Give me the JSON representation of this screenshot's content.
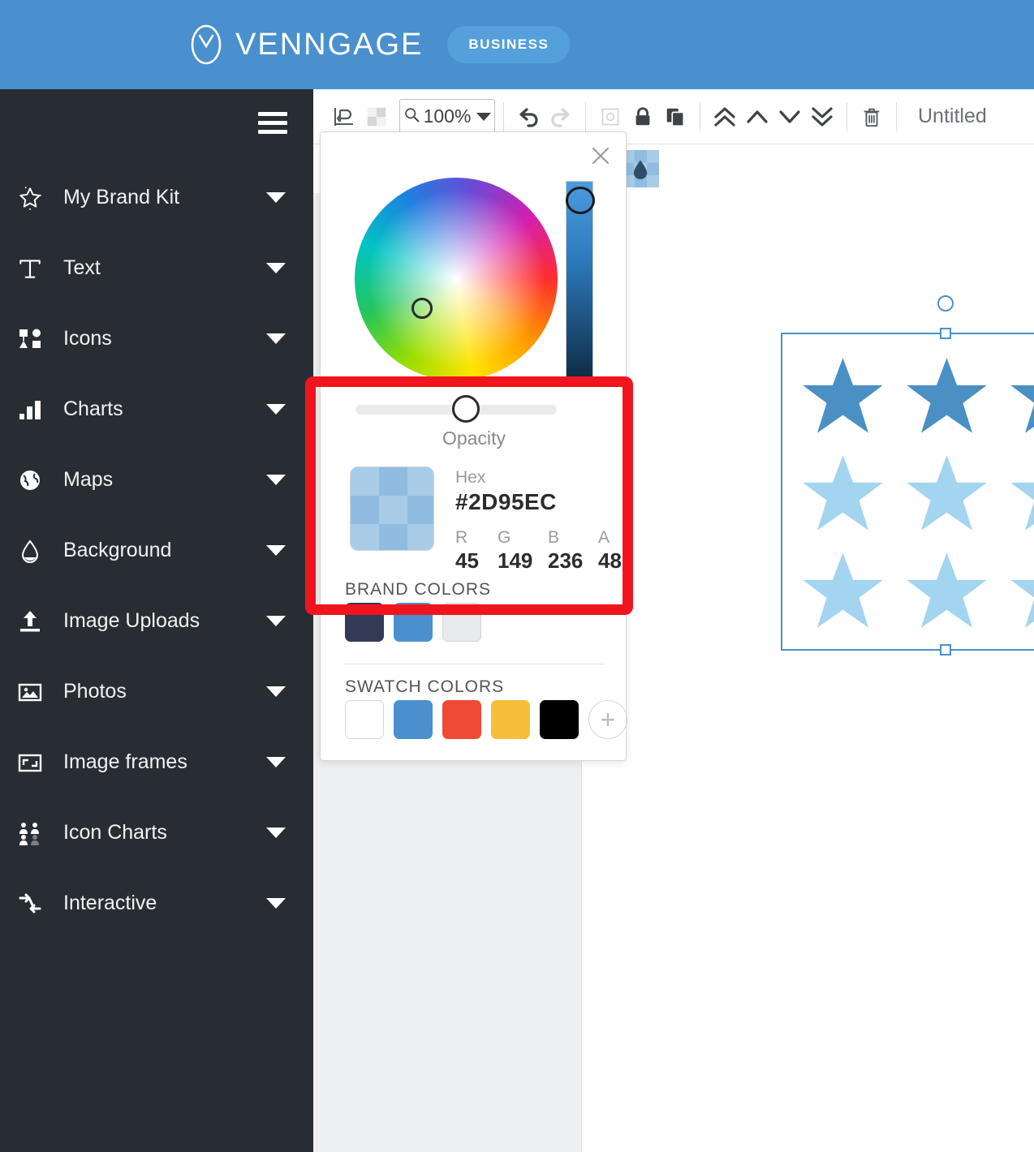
{
  "header": {
    "logo_icon": "venngage-logo-icon",
    "brand_name": "VENNGAGE",
    "plan_badge": "BUSINESS",
    "background_color": "#4A90CF"
  },
  "sidebar": {
    "menu_icon": "hamburger-icon",
    "background_color": "#282D33",
    "items": [
      {
        "label": "My Brand Kit",
        "icon": "star-sparkle-icon"
      },
      {
        "label": "Text",
        "icon": "text-t-icon"
      },
      {
        "label": "Icons",
        "icon": "shapes-icon"
      },
      {
        "label": "Charts",
        "icon": "bar-chart-icon"
      },
      {
        "label": "Maps",
        "icon": "globe-icon"
      },
      {
        "label": "Background",
        "icon": "droplet-icon"
      },
      {
        "label": "Image Uploads",
        "icon": "upload-arrow-icon"
      },
      {
        "label": "Photos",
        "icon": "photo-icon"
      },
      {
        "label": "Image frames",
        "icon": "image-frame-icon"
      },
      {
        "label": "Icon Charts",
        "icon": "people-chart-icon"
      },
      {
        "label": "Interactive",
        "icon": "shuffle-arrows-icon"
      }
    ]
  },
  "toolbar": {
    "align_icon": "align-left-icon",
    "transparency_icon": "checkerboard-icon",
    "zoom_search_icon": "magnifier-icon",
    "zoom_level": "100%",
    "undo_icon": "undo-icon",
    "redo_icon": "redo-icon",
    "crop_icon": "crop-frame-icon",
    "lock_icon": "lock-icon",
    "duplicate_icon": "duplicate-icon",
    "bring_front_icon": "chevrons-up-icon",
    "bring_forward_icon": "chevron-up-icon",
    "send_backward_icon": "chevron-down-icon",
    "send_back_icon": "chevrons-down-icon",
    "delete_icon": "trash-icon",
    "document_title": "Untitled"
  },
  "subtoolbar": {
    "fill_icon": "fill-droplet-icon"
  },
  "color_picker": {
    "close_icon": "close-x-icon",
    "wheel_icon": "color-wheel",
    "brightness_slider_icon": "brightness-slider",
    "opacity_label": "Opacity",
    "opacity_percent": 48,
    "hex_label": "Hex",
    "hex_value": "#2D95EC",
    "channels": [
      {
        "label": "R",
        "value": "45"
      },
      {
        "label": "G",
        "value": "149"
      },
      {
        "label": "B",
        "value": "236"
      },
      {
        "label": "A",
        "value": "48"
      }
    ],
    "brand_colors_title": "BRAND COLORS",
    "brand_colors": [
      "#323A56",
      "#4A90CF",
      "#E8E9EA"
    ],
    "swatch_colors_title": "SWATCH COLORS",
    "swatch_colors": [
      "#FFFFFF",
      "#4A90CF",
      "#EF4A35",
      "#F7BE39",
      "#000000"
    ],
    "add_swatch_icon": "plus-circle-icon"
  },
  "canvas": {
    "selection_icon": "selection-handles",
    "rotate_icon": "rotate-handle-icon",
    "stars": [
      {
        "color": "#4A90C4"
      },
      {
        "color": "#4A90C4"
      },
      {
        "color": "#4A90C4"
      },
      {
        "color": "#A3D4F0"
      },
      {
        "color": "#A3D4F0"
      },
      {
        "color": "#A3D4F0"
      },
      {
        "color": "#A3D4F0"
      },
      {
        "color": "#A3D4F0"
      },
      {
        "color": "#A3D4F0"
      }
    ]
  },
  "annotation": {
    "highlight_color": "#F0141E"
  }
}
